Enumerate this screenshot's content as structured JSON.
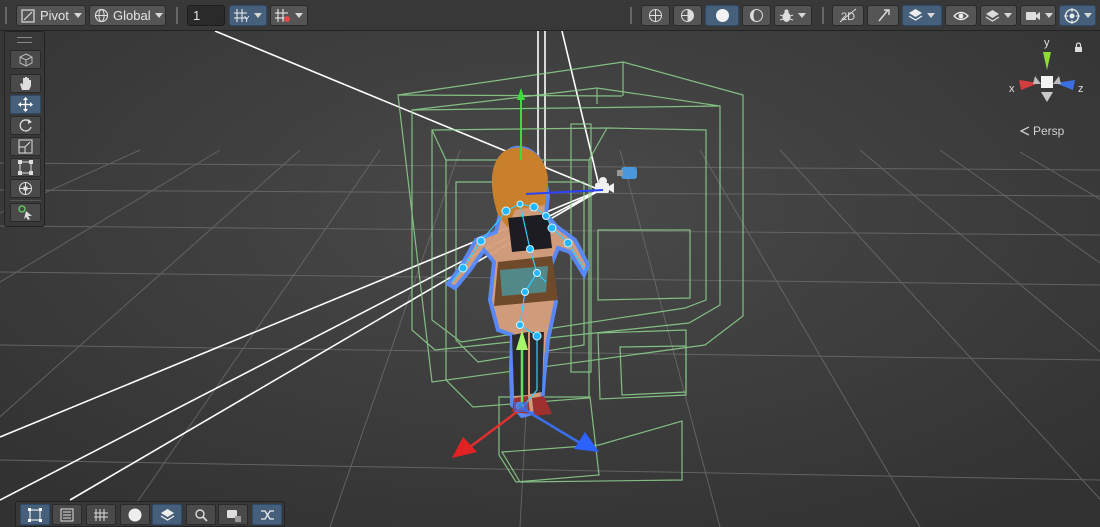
{
  "toolbar": {
    "pivot_label": "Pivot",
    "global_label": "Global",
    "grid_snap_value": "1",
    "accent_color": "#46607c"
  },
  "tools": {
    "items": [
      "view-tool",
      "hand-tool",
      "move-tool",
      "rotate-tool",
      "scale-tool",
      "rect-tool",
      "transform-tool",
      "custom-tool"
    ],
    "active": "move-tool"
  },
  "orientation": {
    "axis_x": "x",
    "axis_y": "y",
    "axis_z": "z",
    "projection_label": "Persp",
    "projection_icon": "persp-arrow-icon"
  },
  "overlay_bar": {
    "items": [
      "rect-icon",
      "tool-settings-icon",
      "grid-icon",
      "circle-icon",
      "layers-icon",
      "search-icon",
      "camera-icon",
      "shuffle-icon"
    ]
  }
}
